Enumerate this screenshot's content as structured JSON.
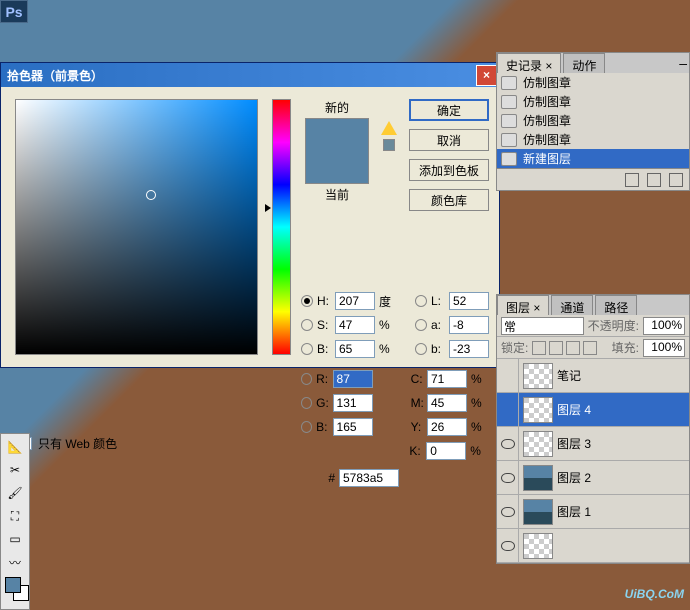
{
  "app": {
    "logo": "Ps"
  },
  "dialog": {
    "title": "拾色器（前景色）",
    "new_label": "新的",
    "current_label": "当前",
    "buttons": {
      "ok": "确定",
      "cancel": "取消",
      "add_swatch": "添加到色板",
      "color_lib": "颜色库"
    },
    "fields": {
      "H": {
        "label": "H:",
        "value": "207",
        "unit": "度"
      },
      "S": {
        "label": "S:",
        "value": "47",
        "unit": "%"
      },
      "Bv": {
        "label": "B:",
        "value": "65",
        "unit": "%"
      },
      "L": {
        "label": "L:",
        "value": "52"
      },
      "a": {
        "label": "a:",
        "value": "-8"
      },
      "b": {
        "label": "b:",
        "value": "-23"
      },
      "R": {
        "label": "R:",
        "value": "87"
      },
      "G": {
        "label": "G:",
        "value": "131"
      },
      "Bc": {
        "label": "B:",
        "value": "165"
      },
      "C": {
        "label": "C:",
        "value": "71",
        "unit": "%"
      },
      "M": {
        "label": "M:",
        "value": "45",
        "unit": "%"
      },
      "Y": {
        "label": "Y:",
        "value": "26",
        "unit": "%"
      },
      "K": {
        "label": "K:",
        "value": "0",
        "unit": "%"
      },
      "hex": {
        "prefix": "#",
        "value": "5783a5"
      }
    },
    "web_only": "只有 Web 颜色"
  },
  "history": {
    "tabs": {
      "history": "史记录 ×",
      "actions": "动作"
    },
    "items": [
      "仿制图章",
      "仿制图章",
      "仿制图章",
      "仿制图章",
      "新建图层"
    ]
  },
  "layers": {
    "tabs": {
      "layers": "图层 ×",
      "channels": "通道",
      "paths": "路径"
    },
    "blend_mode": "常",
    "opacity_label": "不透明度:",
    "opacity": "100%",
    "lock_label": "锁定:",
    "fill_label": "填充:",
    "fill": "100%",
    "items": [
      {
        "name": "笔记"
      },
      {
        "name": "图层 4"
      },
      {
        "name": "图层 3"
      },
      {
        "name": "图层 2"
      },
      {
        "name": "图层 1"
      }
    ]
  },
  "watermark": "UiBQ.CoM"
}
